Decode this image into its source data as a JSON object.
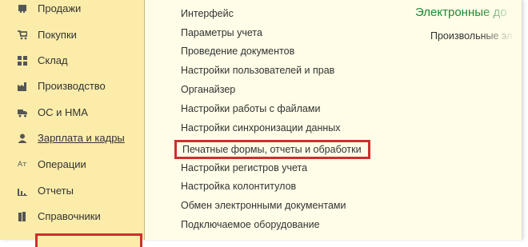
{
  "sidebar": {
    "items": [
      {
        "label": "Продажи",
        "icon": "cart-sale-icon",
        "underlined": false
      },
      {
        "label": "Покупки",
        "icon": "cart-icon",
        "underlined": false
      },
      {
        "label": "Склад",
        "icon": "warehouse-icon",
        "underlined": false
      },
      {
        "label": "Производство",
        "icon": "factory-icon",
        "underlined": false
      },
      {
        "label": "ОС и НМА",
        "icon": "truck-icon",
        "underlined": false
      },
      {
        "label": "Зарплата и кадры",
        "icon": "person-icon",
        "underlined": true
      },
      {
        "label": "Операции",
        "icon": "operations-icon",
        "underlined": false
      },
      {
        "label": "Отчеты",
        "icon": "bar-chart-icon",
        "underlined": false
      },
      {
        "label": "Справочники",
        "icon": "books-icon",
        "underlined": false
      }
    ]
  },
  "settings_menu": {
    "items": [
      "Интерфейс",
      "Параметры учета",
      "Проведение документов",
      "Настройки пользователей и прав",
      "Органайзер",
      "Настройки работы с файлами",
      "Настройки синхронизации данных",
      "Печатные формы, отчеты и обработки",
      "Настройки регистров учета",
      "Настройка колонтитулов",
      "Обмен электронными документами",
      "Подключаемое оборудование"
    ],
    "highlighted_index": 7
  },
  "right_panel": {
    "title": "Электронные до",
    "subtitle": "Произвольные эл"
  },
  "colors": {
    "sidebar_bg": "#fbecaa",
    "content_bg": "#fffde7",
    "highlight_border": "#d12d2d",
    "title_green": "#1d8a37",
    "text": "#333333"
  }
}
